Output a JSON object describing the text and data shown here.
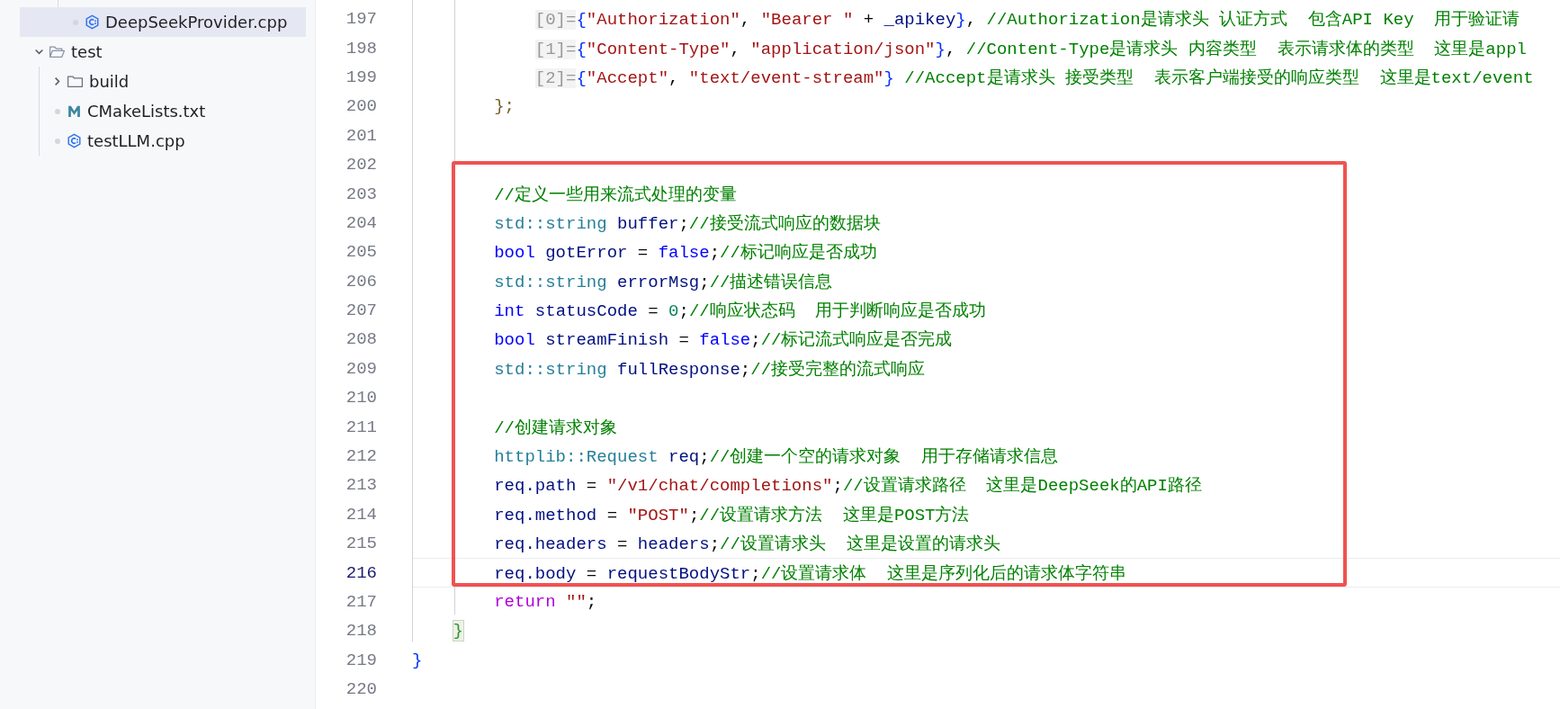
{
  "explorer": {
    "above": [
      {
        "kind": "cpp",
        "name": "DeepSeekProvider.cpp",
        "selected": true
      }
    ],
    "tree": [
      {
        "kind": "folder",
        "name": "test",
        "expanded": true,
        "selected": false,
        "children": [
          {
            "kind": "folder",
            "name": "build",
            "expanded": false,
            "selected": false
          },
          {
            "kind": "cmake",
            "name": "CMakeLists.txt",
            "selected": false
          },
          {
            "kind": "cpp",
            "name": "testLLM.cpp",
            "selected": false
          }
        ]
      }
    ]
  },
  "editor": {
    "lines": [
      {
        "children": [
          {
            "children": [
              {
                "children": [
                  {
                    "number": "197",
                    "current": false,
                    "tokens": [
                      {
                        "kind": "hint",
                        "text": "[0]="
                      },
                      {
                        "kind": "brace",
                        "text": "{"
                      },
                      {
                        "kind": "str",
                        "text": "\"Authorization\""
                      },
                      {
                        "kind": "punct",
                        "text": ", "
                      },
                      {
                        "kind": "str",
                        "text": "\"Bearer \""
                      },
                      {
                        "kind": "punct",
                        "text": " + "
                      },
                      {
                        "kind": "var",
                        "text": "_apikey"
                      },
                      {
                        "kind": "brace",
                        "text": "}"
                      },
                      {
                        "kind": "punct",
                        "text": ", "
                      },
                      {
                        "kind": "cmt",
                        "text": "//Authorization是请求头 认证方式  包含API Key  用于验证请"
                      }
                    ]
                  },
                  {
                    "number": "198",
                    "current": false,
                    "tokens": [
                      {
                        "kind": "hint",
                        "text": "[1]="
                      },
                      {
                        "kind": "brace",
                        "text": "{"
                      },
                      {
                        "kind": "str",
                        "text": "\"Content-Type\""
                      },
                      {
                        "kind": "punct",
                        "text": ", "
                      },
                      {
                        "kind": "str",
                        "text": "\"application/json\""
                      },
                      {
                        "kind": "brace",
                        "text": "}"
                      },
                      {
                        "kind": "punct",
                        "text": ", "
                      },
                      {
                        "kind": "cmt",
                        "text": "//Content-Type是请求头 内容类型  表示请求体的类型  这里是appl"
                      }
                    ]
                  },
                  {
                    "number": "199",
                    "current": false,
                    "tokens": [
                      {
                        "kind": "hint",
                        "text": "[2]="
                      },
                      {
                        "kind": "brace",
                        "text": "{"
                      },
                      {
                        "kind": "str",
                        "text": "\"Accept\""
                      },
                      {
                        "kind": "punct",
                        "text": ", "
                      },
                      {
                        "kind": "str",
                        "text": "\"text/event-stream\""
                      },
                      {
                        "kind": "brace",
                        "text": "}"
                      },
                      {
                        "kind": "cmt",
                        "text": " //Accept是请求头 接受类型  表示客户端接受的响应类型  这里是text/event"
                      }
                    ]
                  }
                ]
              },
              {
                "number": "200",
                "current": false,
                "tokens": [
                  {
                    "kind": "close",
                    "text": "};"
                  }
                ]
              },
              {
                "number": "201",
                "current": false
              },
              {
                "number": "202",
                "current": false
              },
              {
                "number": "203",
                "current": false,
                "tokens": [
                  {
                    "kind": "cmt",
                    "text": "//定义一些用来流式处理的变量"
                  }
                ]
              },
              {
                "number": "204",
                "current": false,
                "tokens": [
                  {
                    "kind": "type",
                    "text": "std::string"
                  },
                  {
                    "kind": "var",
                    "text": " buffer"
                  },
                  {
                    "kind": "punct",
                    "text": ";"
                  },
                  {
                    "kind": "cmt",
                    "text": "//接受流式响应的数据块"
                  }
                ]
              },
              {
                "number": "205",
                "current": false,
                "tokens": [
                  {
                    "kind": "kw",
                    "text": "bool"
                  },
                  {
                    "kind": "var",
                    "text": " gotError"
                  },
                  {
                    "kind": "punct",
                    "text": " = "
                  },
                  {
                    "kind": "kw",
                    "text": "false"
                  },
                  {
                    "kind": "punct",
                    "text": ";"
                  },
                  {
                    "kind": "cmt",
                    "text": "//标记响应是否成功"
                  }
                ]
              },
              {
                "number": "206",
                "current": false,
                "tokens": [
                  {
                    "kind": "type",
                    "text": "std::string"
                  },
                  {
                    "kind": "var",
                    "text": " errorMsg"
                  },
                  {
                    "kind": "punct",
                    "text": ";"
                  },
                  {
                    "kind": "cmt",
                    "text": "//描述错误信息"
                  }
                ]
              },
              {
                "number": "207",
                "current": false,
                "tokens": [
                  {
                    "kind": "kw",
                    "text": "int"
                  },
                  {
                    "kind": "var",
                    "text": " statusCode"
                  },
                  {
                    "kind": "punct",
                    "text": " = "
                  },
                  {
                    "kind": "num",
                    "text": "0"
                  },
                  {
                    "kind": "punct",
                    "text": ";"
                  },
                  {
                    "kind": "cmt",
                    "text": "//响应状态码  用于判断响应是否成功"
                  }
                ]
              },
              {
                "number": "208",
                "current": false,
                "tokens": [
                  {
                    "kind": "kw",
                    "text": "bool"
                  },
                  {
                    "kind": "var",
                    "text": " streamFinish"
                  },
                  {
                    "kind": "punct",
                    "text": " = "
                  },
                  {
                    "kind": "kw",
                    "text": "false"
                  },
                  {
                    "kind": "punct",
                    "text": ";"
                  },
                  {
                    "kind": "cmt",
                    "text": "//标记流式响应是否完成"
                  }
                ]
              },
              {
                "number": "209",
                "current": false,
                "tokens": [
                  {
                    "kind": "type",
                    "text": "std::string"
                  },
                  {
                    "kind": "var",
                    "text": " fullResponse"
                  },
                  {
                    "kind": "punct",
                    "text": ";"
                  },
                  {
                    "kind": "cmt",
                    "text": "//接受完整的流式响应"
                  }
                ]
              },
              {
                "number": "210",
                "current": false
              },
              {
                "number": "211",
                "current": false,
                "tokens": [
                  {
                    "kind": "cmt",
                    "text": "//创建请求对象"
                  }
                ]
              },
              {
                "number": "212",
                "current": false,
                "tokens": [
                  {
                    "kind": "type",
                    "text": "httplib::Request"
                  },
                  {
                    "kind": "var",
                    "text": " req"
                  },
                  {
                    "kind": "punct",
                    "text": ";"
                  },
                  {
                    "kind": "cmt",
                    "text": "//创建一个空的请求对象  用于存储请求信息"
                  }
                ]
              },
              {
                "number": "213",
                "current": false,
                "tokens": [
                  {
                    "kind": "var",
                    "text": "req.path"
                  },
                  {
                    "kind": "punct",
                    "text": " = "
                  },
                  {
                    "kind": "str",
                    "text": "\"/v1/chat/completions\""
                  },
                  {
                    "kind": "punct",
                    "text": ";"
                  },
                  {
                    "kind": "cmt",
                    "text": "//设置请求路径  这里是DeepSeek的API路径"
                  }
                ]
              },
              {
                "number": "214",
                "current": false,
                "tokens": [
                  {
                    "kind": "var",
                    "text": "req.method"
                  },
                  {
                    "kind": "punct",
                    "text": " = "
                  },
                  {
                    "kind": "str",
                    "text": "\"POST\""
                  },
                  {
                    "kind": "punct",
                    "text": ";"
                  },
                  {
                    "kind": "cmt",
                    "text": "//设置请求方法  这里是POST方法"
                  }
                ]
              },
              {
                "number": "215",
                "current": false,
                "tokens": [
                  {
                    "kind": "var",
                    "text": "req.headers"
                  },
                  {
                    "kind": "punct",
                    "text": " = "
                  },
                  {
                    "kind": "var",
                    "text": "headers"
                  },
                  {
                    "kind": "punct",
                    "text": ";"
                  },
                  {
                    "kind": "cmt",
                    "text": "//设置请求头  这里是设置的请求头"
                  }
                ]
              },
              {
                "number": "216",
                "current": true,
                "tokens": [
                  {
                    "kind": "var",
                    "text": "req.body"
                  },
                  {
                    "kind": "punct",
                    "text": " = "
                  },
                  {
                    "kind": "var",
                    "text": "requestBodyStr"
                  },
                  {
                    "kind": "punct",
                    "text": ";"
                  },
                  {
                    "kind": "cmt",
                    "text": "//设置请求体  这里是序列化后的请求体字符串"
                  }
                ]
              },
              {
                "number": "217",
                "current": false,
                "tokens": [
                  {
                    "kind": "ctrl",
                    "text": "return"
                  },
                  {
                    "kind": "str",
                    "text": " \"\""
                  },
                  {
                    "kind": "punct",
                    "text": ";"
                  }
                ]
              }
            ]
          },
          {
            "number": "218",
            "current": false,
            "tokens": [
              {
                "kind": "match",
                "text": "}"
              }
            ]
          }
        ]
      },
      {
        "number": "219",
        "current": false,
        "tokens": [
          {
            "kind": "brace",
            "text": "}"
          }
        ]
      },
      {
        "number": "220",
        "current": false
      }
    ]
  }
}
